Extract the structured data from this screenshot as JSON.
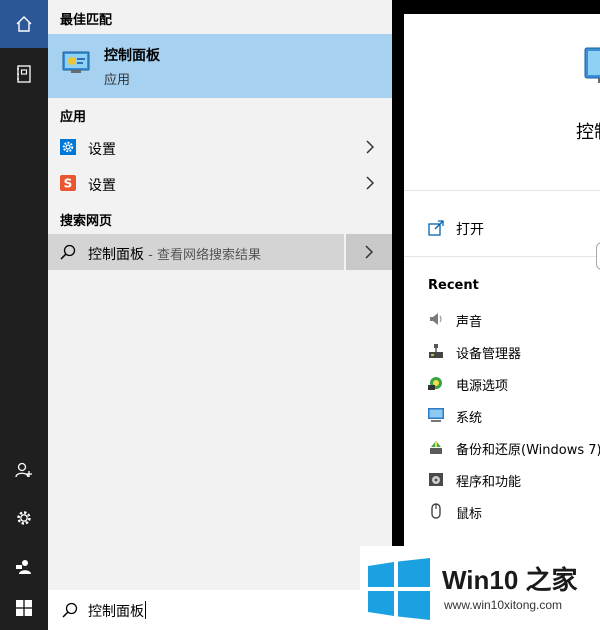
{
  "icons": {
    "home": "home-icon",
    "notebook": "notebook-icon",
    "people": "people-icon",
    "settings": "gear-icon",
    "feedback": "feedback-icon",
    "start": "windows-start-icon",
    "search": "search-icon"
  },
  "results": {
    "best_match_title": "最佳匹配",
    "best_match": {
      "name": "控制面板",
      "type": "应用"
    },
    "apps_title": "应用",
    "apps": [
      {
        "label": "设置",
        "icon": "gear-settings-icon"
      },
      {
        "label": "设置",
        "icon": "sogou-settings-icon"
      }
    ],
    "web_title": "搜索网页",
    "web_result": {
      "label": "控制面板",
      "sub": " - 查看网络搜索结果"
    }
  },
  "searchbox": {
    "value": "控制面板"
  },
  "preview": {
    "title": "控制",
    "open_label": "打开",
    "recent_title": "Recent",
    "recent": [
      {
        "label": "声音",
        "icon": "speaker-icon"
      },
      {
        "label": "设备管理器",
        "icon": "device-manager-icon"
      },
      {
        "label": "电源选项",
        "icon": "power-options-icon"
      },
      {
        "label": "系统",
        "icon": "system-icon"
      },
      {
        "label": "备份和还原(Windows 7)",
        "icon": "backup-icon"
      },
      {
        "label": "程序和功能",
        "icon": "programs-icon"
      },
      {
        "label": "鼠标",
        "icon": "mouse-icon"
      }
    ]
  },
  "watermark": {
    "name": "Win10 之家",
    "url": "www.win10xitong.com"
  },
  "colors": {
    "accent": "#2b5797",
    "highlight": "#a6d1f0",
    "rail": "#1f1f1f",
    "logo_blue": "#1ba1e2"
  }
}
